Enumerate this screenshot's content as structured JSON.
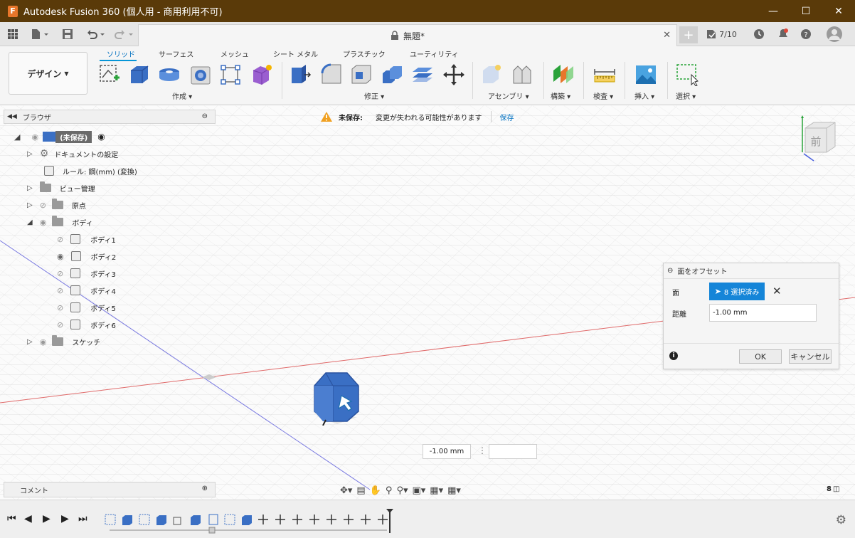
{
  "window": {
    "app_icon_letter": "F",
    "title": "Autodesk Fusion 360 (個人用 - 商用利用不可)"
  },
  "qat": {
    "doc_title": "無題*",
    "job_status": "7/10"
  },
  "ribbon": {
    "workspace": "デザイン",
    "tabs": [
      "ソリッド",
      "サーフェス",
      "メッシュ",
      "シート メタル",
      "プラスチック",
      "ユーティリティ"
    ],
    "groups": {
      "create": "作成",
      "modify": "修正",
      "assembly": "アセンブリ",
      "construct": "構築",
      "inspect": "検査",
      "insert": "挿入",
      "select": "選択"
    }
  },
  "warning": {
    "label": "未保存:",
    "message": "変更が失われる可能性があります",
    "save": "保存"
  },
  "browser": {
    "header": "ブラウザ",
    "root": "(未保存)",
    "items": {
      "doc_settings": "ドキュメントの設定",
      "units": "ルール: 鋼(mm) (変換)",
      "named_views": "ビュー管理",
      "origin": "原点",
      "bodies": "ボディ",
      "body1": "ボディ1",
      "body2": "ボディ2",
      "body3": "ボディ3",
      "body4": "ボディ4",
      "body5": "ボディ5",
      "body6": "ボディ6",
      "sketches": "スケッチ"
    }
  },
  "comments": {
    "label": "コメント"
  },
  "viewcube": {
    "face": "前"
  },
  "dialog": {
    "title": "面をオフセット",
    "face_label": "面",
    "face_value": "8 選択済み",
    "distance_label": "距離",
    "distance_value": "-1.00 mm",
    "ok": "OK",
    "cancel": "キャンセル"
  },
  "viewport_input": {
    "value": "-1.00 mm"
  },
  "status": {
    "count": "8"
  },
  "colors": {
    "titlebar": "#5a3a09",
    "accent": "#0696d7",
    "selected": "#1585d8",
    "body_blue": "#3a6fc4"
  }
}
